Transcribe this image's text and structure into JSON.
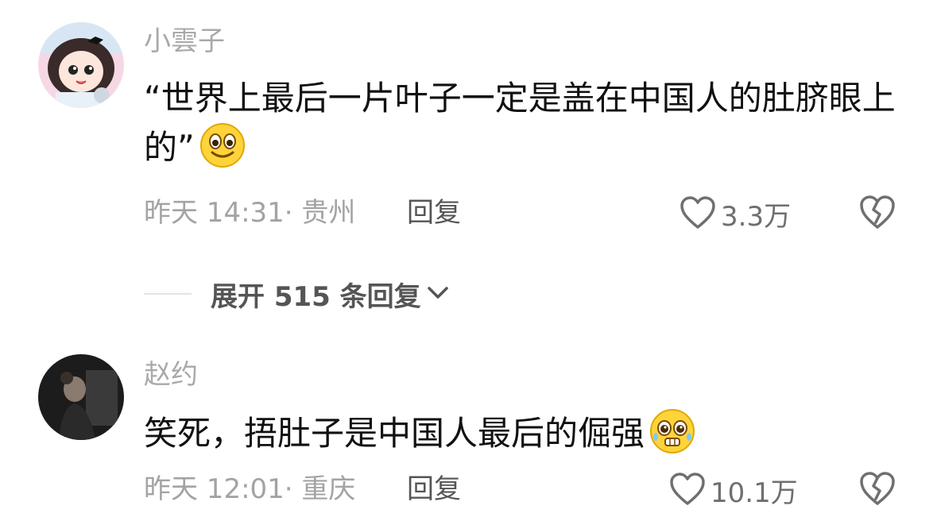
{
  "comments": [
    {
      "username": "小雲子",
      "text": "“世界上最后一片叶子一定是盖在中国人的肚脐眼上的”",
      "emoji": "smile-emoji",
      "time": "昨天 14:31",
      "location": "· 贵州",
      "reply_label": "回复",
      "likes": "3.3万"
    },
    {
      "username": "赵约",
      "text": "笑死，捂肚子是中国人最后的倔强",
      "emoji": "pleading-emoji",
      "time": "昨天 12:01",
      "location": "· 重庆",
      "reply_label": "回复",
      "likes": "10.1万"
    }
  ],
  "expand_replies": {
    "label": "展开 515 条回复"
  },
  "colors": {
    "username": "#a9a9a9",
    "text": "#111111",
    "meta": "#a3a3a3",
    "action": "#555555"
  }
}
